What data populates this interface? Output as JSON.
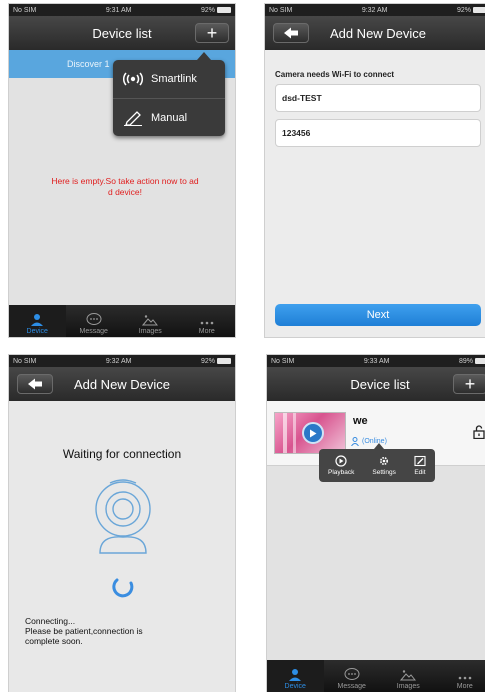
{
  "status": {
    "carrier": "No SIM",
    "time1": "9:31 AM",
    "time2": "9:32 AM",
    "time3": "9:32 AM",
    "time4": "9:33 AM",
    "battery1": "92%",
    "battery2": "92%",
    "battery3": "92%",
    "battery4": "89%"
  },
  "screen1": {
    "title": "Device list",
    "plus": "+",
    "banner": "Discover 1",
    "menu": [
      "Smartlink",
      "Manual"
    ],
    "empty_message_line1": "Here is empty.So take action now to ad",
    "empty_message_line2": "d device!"
  },
  "screen2": {
    "title": "Add New Device",
    "label": "Camera needs Wi-Fi to connect",
    "ssid": "dsd-TEST",
    "password": "123456",
    "next": "Next"
  },
  "screen3": {
    "title": "Add New Device",
    "waiting": "Waiting for connection",
    "connecting_line1": "Connecting...",
    "connecting_line2": "Please be patient,connection is",
    "connecting_line3": "complete soon."
  },
  "screen4": {
    "title": "Device list",
    "plus": "+",
    "device_name": "we",
    "device_status": "(Online)",
    "actions": [
      "Playback",
      "Settings",
      "Edit"
    ]
  },
  "tabs": [
    "Device",
    "Message",
    "Images",
    "More"
  ],
  "colors": {
    "accent": "#2d8ee6",
    "error": "#e02020",
    "banner": "#59a6de"
  }
}
